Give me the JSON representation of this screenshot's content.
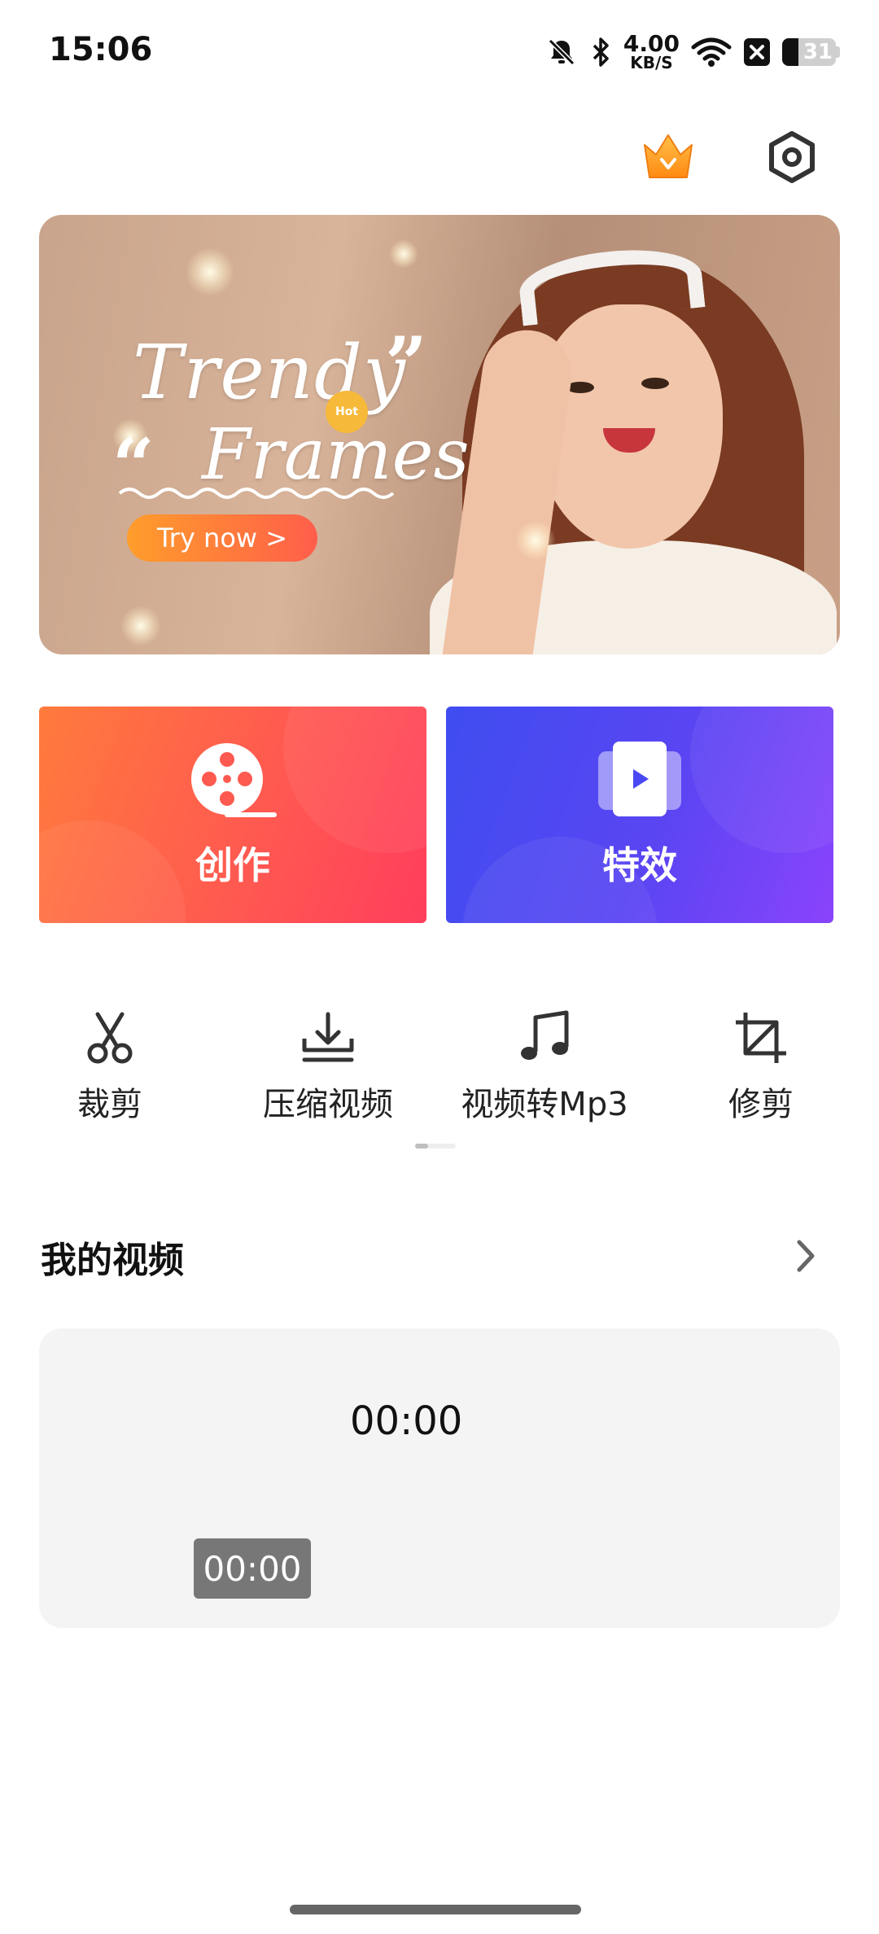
{
  "status_bar": {
    "time": "15:06",
    "net_speed_value": "4.00",
    "net_speed_unit": "KB/S",
    "battery_level": "31",
    "icons": [
      "bell-muted-icon",
      "bluetooth-icon",
      "wifi-icon",
      "app-notification-icon",
      "battery-icon"
    ]
  },
  "header": {
    "icons": [
      "crown-icon",
      "settings-icon"
    ],
    "crown_color": "#ff9a1f"
  },
  "banner": {
    "title_line1": "Trendy",
    "title_line2": "Frames",
    "quote_open": "“",
    "quote_close": "”",
    "badge": "Hot",
    "cta": "Try now >"
  },
  "cards": {
    "create": {
      "label": "创作",
      "icon": "film-reel-icon",
      "color_start": "#ff7a3c",
      "color_end": "#ff3e5c"
    },
    "effects": {
      "label": "特效",
      "icon": "video-play-icon",
      "color_start": "#3f4df0",
      "color_end": "#8a43fb"
    }
  },
  "tools": [
    {
      "label": "裁剪",
      "icon": "scissors-icon"
    },
    {
      "label": "压缩视频",
      "icon": "download-compress-icon"
    },
    {
      "label": "视频转Mp3",
      "icon": "music-note-icon"
    },
    {
      "label": "修剪",
      "icon": "crop-icon"
    }
  ],
  "my_videos": {
    "title": "我的视频",
    "video": {
      "date_label": "00:00",
      "duration": "00:00"
    }
  }
}
